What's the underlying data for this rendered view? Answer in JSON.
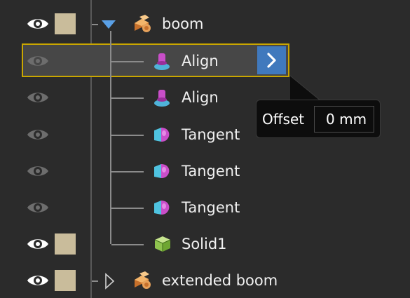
{
  "tree": {
    "items": [
      {
        "label": "boom",
        "visible": true,
        "color": "#c9bc9b",
        "expanded": true,
        "icon": "component-icon",
        "depth": 0
      },
      {
        "label": "Align",
        "visible": false,
        "icon": "align-constraint-icon",
        "depth": 1,
        "selected": true
      },
      {
        "label": "Align",
        "visible": false,
        "icon": "align-constraint-icon",
        "depth": 1
      },
      {
        "label": "Tangent",
        "visible": false,
        "icon": "tangent-constraint-icon",
        "depth": 1
      },
      {
        "label": "Tangent",
        "visible": false,
        "icon": "tangent-constraint-icon",
        "depth": 1
      },
      {
        "label": "Tangent",
        "visible": false,
        "icon": "tangent-constraint-icon",
        "depth": 1
      },
      {
        "label": "Solid1",
        "visible": true,
        "color": "#c9bc9b",
        "icon": "solid-body-icon",
        "depth": 1
      },
      {
        "label": "extended boom",
        "visible": true,
        "color": "#c9bc9b",
        "expanded": false,
        "icon": "component-icon",
        "depth": 0
      }
    ]
  },
  "tooltip": {
    "offset_label": "Offset",
    "offset_value": "0 mm"
  },
  "colors": {
    "panel_background": "#2b2b2b",
    "selection_border": "#c9a600",
    "accent_button": "#4079bd",
    "swatch": "#c9bc9b"
  }
}
